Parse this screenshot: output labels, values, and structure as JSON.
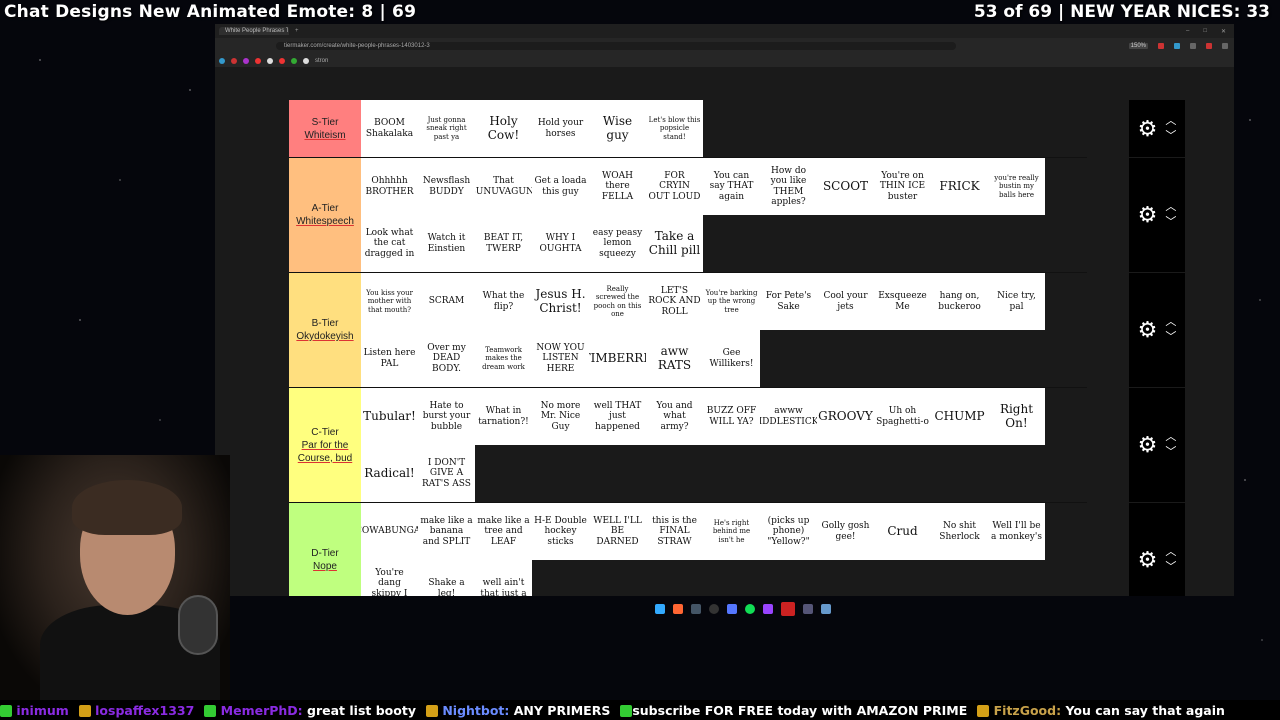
{
  "overlay": {
    "title": "Chat Designs New Animated Emote: 8 | 69",
    "counter": "53 of 69 | NEW YEAR NICES: 33"
  },
  "browser": {
    "tab_title": "White People Phrases Ti",
    "url": "tiermaker.com/create/white-people-phrases-1403012-3",
    "zoom": "150%",
    "bookmark_folder": "stron"
  },
  "colors": {
    "S": "#ff7f7f",
    "A": "#ffbf7f",
    "B": "#ffdf7f",
    "C": "#ffff7f",
    "D": "#bfff7f"
  },
  "tiers": [
    {
      "id": "S",
      "label_line1": "S-Tier",
      "label_name": "Whiteism",
      "items": [
        "BOOM Shakalaka",
        "Just gonna sneak right past ya",
        "Holy Cow!",
        "Hold your horses",
        "Wise guy",
        "Let's blow this popsicle stand!"
      ]
    },
    {
      "id": "A",
      "label_line1": "A-Tier",
      "label_name": "Whitespeech",
      "items": [
        "Ohhhhh BROTHER",
        "Newsflash BUDDY",
        "That SUNUVAGUN!",
        "Get a loada this guy",
        "WOAH there FELLA",
        "FOR CRYIN OUT LOUD",
        "You can say THAT again",
        "How do you like THEM apples?",
        "SCOOT",
        "You're on THIN ICE buster",
        "FRICK",
        "you're really bustin my balls here",
        "Look what the cat dragged in",
        "Watch it Einstien",
        "BEAT IT, TWERP",
        "WHY I OUGHTA",
        "easy peasy lemon squeezy",
        "Take a Chill pill"
      ]
    },
    {
      "id": "B",
      "label_line1": "B-Tier",
      "label_name": "Okydokeyish",
      "items": [
        "You kiss your mother with that mouth?",
        "SCRAM",
        "What the flip?",
        "Jesus H. Christ!",
        "Really screwed the pooch on this one",
        "LET'S ROCK AND ROLL",
        "You're barking up the wrong tree",
        "For Pete's Sake",
        "Cool your jets",
        "Exsqueeze Me",
        "hang on, buckeroo",
        "Nice try, pal",
        "Listen here PAL",
        "Over my DEAD BODY.",
        "Teamwork makes the dream work",
        "NOW YOU LISTEN HERE",
        "TIMBERRR",
        "aww RATS",
        "Gee Willikers!"
      ]
    },
    {
      "id": "C",
      "label_line1": "C-Tier",
      "label_name": "Par for the Course, bud",
      "items": [
        "Tubular!",
        "Hate to burst your bubble",
        "What in tarnation?!",
        "No more Mr. Nice Guy",
        "well THAT just happened",
        "You and what army?",
        "BUZZ OFF WILL YA?",
        "awww FIDDLESTICKS",
        "GROOVY",
        "Uh oh Spaghetti-o",
        "CHUMP",
        "Right On!",
        "Radical!",
        "I DON'T GIVE A RAT'S ASS"
      ]
    },
    {
      "id": "D",
      "label_line1": "D-Tier",
      "label_name": "Nope",
      "items": [
        "COWABUNGA!",
        "make like a banana and SPLIT",
        "make like a tree and LEAF",
        "H-E Double hockey sticks",
        "WELL I'LL BE DARNED",
        "this is the FINAL STRAW",
        "He's right behind me isn't he",
        "(picks up phone) \"Yellow?\"",
        "Golly gosh gee!",
        "Crud",
        "No shit Sherlock",
        "Well I'll be a monkey's",
        "You're dang skippy I do!",
        "Shake a leg!",
        "well ain't that just a"
      ]
    }
  ],
  "ticker": [
    {
      "user": "inimum",
      "msg": ""
    },
    {
      "user": "lospaffex1337",
      "msg": ""
    },
    {
      "user": "MemerPhD",
      "msg": "great list booty"
    },
    {
      "user": "Nightbot",
      "msg": "ANY PRIMERS"
    },
    {
      "user": "",
      "msg": "subscribe FOR FREE today with AMAZON PRIME"
    },
    {
      "user": "FitzGood",
      "msg": "You can say that again"
    }
  ]
}
